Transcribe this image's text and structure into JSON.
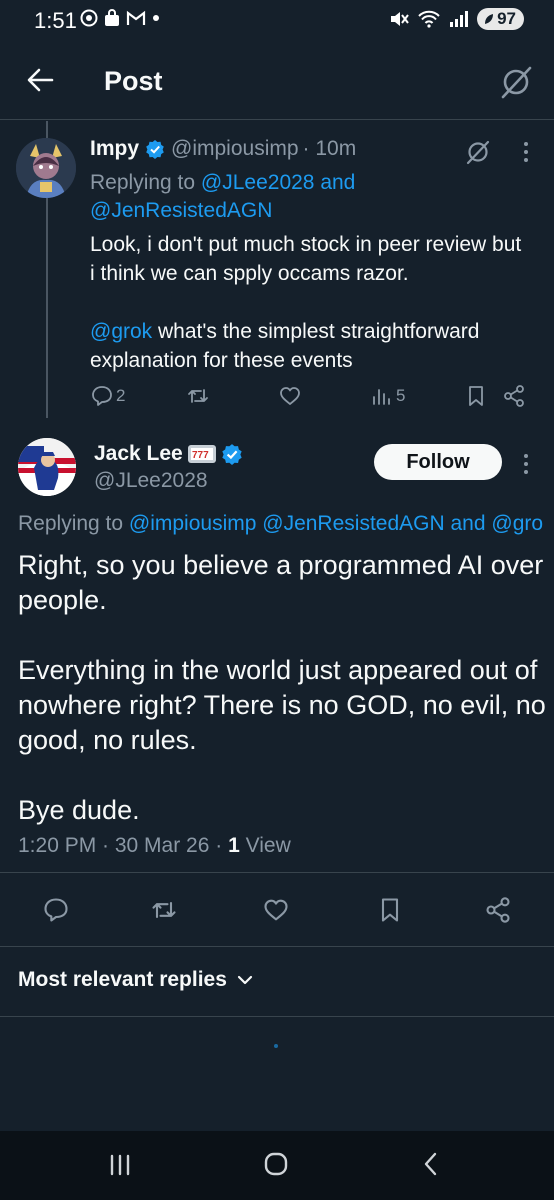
{
  "status_bar": {
    "time": "1:51",
    "battery": "97"
  },
  "header": {
    "title": "Post"
  },
  "reply_tweet": {
    "name": "Impy",
    "handle": "@impiousimp",
    "time": "· 10m",
    "replying_prefix": "Replying to ",
    "replying_to_1": "@JLee2028",
    "replying_and": " and",
    "replying_to_2": "@JenResistedAGN",
    "body_line1": "Look, i don't put much stock in peer review but i think we can spply occams razor.",
    "mention": "@grok",
    "body_line2": " what's the simplest straightforward explanation for these events",
    "reply_count": "2",
    "views_count": "5"
  },
  "main_tweet": {
    "name": "Jack Lee",
    "handle": "@JLee2028",
    "follow_label": "Follow",
    "replying_prefix": "Replying to ",
    "replying_to": "@impiousimp @JenResistedAGN",
    "replying_and": " and ",
    "replying_more": "@gro",
    "body_p1": "Right, so you believe a programmed AI over people.",
    "body_p2": "Everything in the world just appeared out of nowhere right? There is no GOD, no evil, no good, no rules.",
    "body_p3": "Bye dude.",
    "timestamp": "1:20 PM · 30 Mar 26 · ",
    "view_count": "1",
    "view_label": " View"
  },
  "replies": {
    "sort_label": "Most relevant replies"
  },
  "colors": {
    "background": "#15202b",
    "accent": "#1d9bf0",
    "muted": "#8b98a5",
    "divider": "#38444d"
  }
}
